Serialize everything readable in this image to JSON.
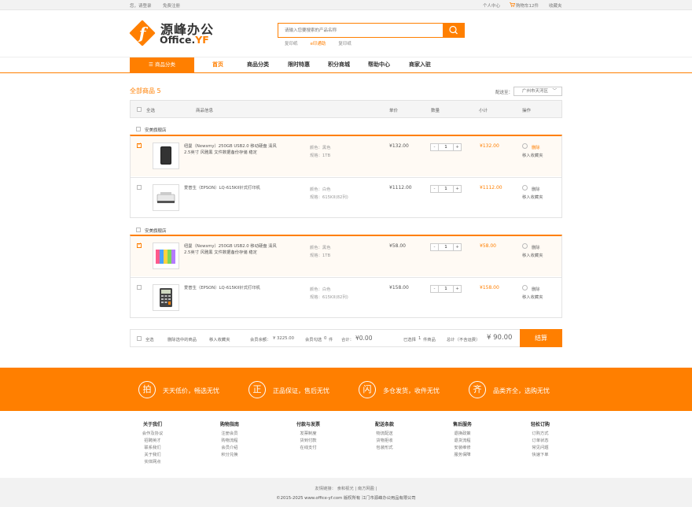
{
  "topbar": {
    "greeting": "您，请登录",
    "register": "免费注册",
    "personal": "个人中心",
    "cart": "购物车12件",
    "favorites": "收藏夹"
  },
  "logo": {
    "cn": "源峰办公",
    "en_main": "Office.",
    "en_accent": "YF",
    "glyph": "f"
  },
  "search": {
    "placeholder": "请输入您要搜索的产品名称",
    "hot_words": [
      "复印纸",
      "e印通助",
      "复印纸"
    ]
  },
  "nav": {
    "category_button": "☰  商品分类",
    "items": [
      "首页",
      "商品分类",
      "限时特惠",
      "积分商城",
      "帮助中心",
      "商家入驻"
    ],
    "active_index": 0
  },
  "cart": {
    "title": "全部商品 5",
    "ship_label": "配送至：",
    "ship_region": "广州市天河区",
    "headers": {
      "select_all": "全选",
      "info": "商品信息",
      "price": "单价",
      "qty": "数量",
      "subtotal": "小计",
      "action": "操作"
    },
    "groups": [
      {
        "shop": "安美旗舰店",
        "items": [
          {
            "checked": true,
            "name": "纽曼（Newsmy）250GB USB2.0 移动硬盘 清风 2.5英寸 风雅黑 文件数据备份存储 稳定",
            "color": "颜色：黑色",
            "spec": "规格：1TB",
            "price": "¥132.00",
            "qty": "1",
            "subtotal": "¥132.00",
            "delete": "删除",
            "fav": "移入收藏夹"
          },
          {
            "checked": false,
            "name": "爱普生（EPSON）LQ-615KII针式打印机",
            "color": "颜色：白色",
            "spec": "规格：615KII(82列)",
            "price": "¥1112.00",
            "qty": "1",
            "subtotal": "¥1112.00",
            "delete": "删除",
            "fav": "移入收藏夹"
          }
        ]
      },
      {
        "shop": "安美旗舰店",
        "items": [
          {
            "checked": true,
            "name": "纽曼（Newsmy）250GB USB2.0 移动硬盘 清风 2.5英寸 风雅黑 文件数据备份存储 稳定",
            "color": "颜色：黑色",
            "spec": "规格：1TB",
            "price": "¥58.00",
            "qty": "1",
            "subtotal": "¥58.00",
            "delete": "删除",
            "fav": "移入收藏夹"
          },
          {
            "checked": false,
            "name": "爱普生（EPSON）LQ-615KII针式打印机",
            "color": "颜色：白色",
            "spec": "规格：615KII(82列)",
            "price": "¥158.00",
            "qty": "1",
            "subtotal": "¥158.00",
            "delete": "删除",
            "fav": "移入收藏夹"
          }
        ]
      }
    ],
    "summary": {
      "select_all": "全选",
      "delete_selected": "删除选中的商品",
      "move_fav": "移入收藏夹",
      "balance_label": "会员余额：",
      "balance": "¥ 3225.00",
      "points_label": "会员勾选",
      "points": "0",
      "points_unit": "件",
      "total_label": "合计：",
      "total": "¥0.00",
      "selected_label": "已选择",
      "selected_count": "1",
      "selected_unit": "件商品",
      "grand_label": "总计（不含运费）",
      "grand": "¥ 90.00",
      "checkout": "结算"
    }
  },
  "features": [
    {
      "icon": "拍",
      "text": "天天低价，畅选无忧"
    },
    {
      "icon": "正",
      "text": "正品保证，售后无忧"
    },
    {
      "icon": "闪",
      "text": "多仓发货，收件无忧"
    },
    {
      "icon": "齐",
      "text": "品类齐全，选购无忧"
    }
  ],
  "footer": {
    "columns": [
      {
        "title": "关于我们",
        "links": [
          "会作及协议",
          "招聘英才",
          "联系我们",
          "关于我们",
          "实体网点"
        ]
      },
      {
        "title": "购物指南",
        "links": [
          "注册会员",
          "购物流程",
          "会员介绍",
          "积分兑换"
        ]
      },
      {
        "title": "付款与发票",
        "links": [
          "发票制度",
          "货到付款",
          "在线支付"
        ]
      },
      {
        "title": "配送条款",
        "links": [
          "物流配送",
          "货物拒收",
          "包装形式"
        ]
      },
      {
        "title": "售后服务",
        "links": [
          "退换政策",
          "退货流程",
          "安装维修",
          "服务保障"
        ]
      },
      {
        "title": "轻松订购",
        "links": [
          "订购方式",
          "订单状态",
          "常见问题",
          "快速下单"
        ]
      }
    ],
    "friend_links": "友情链接： 食和视光 | 南方网盈 |",
    "copyright": "©2015-2025 www.office-yf.com 版权所有  江门市源峰办公用品有限公司"
  },
  "colors": {
    "accent": "#ff7f00"
  }
}
